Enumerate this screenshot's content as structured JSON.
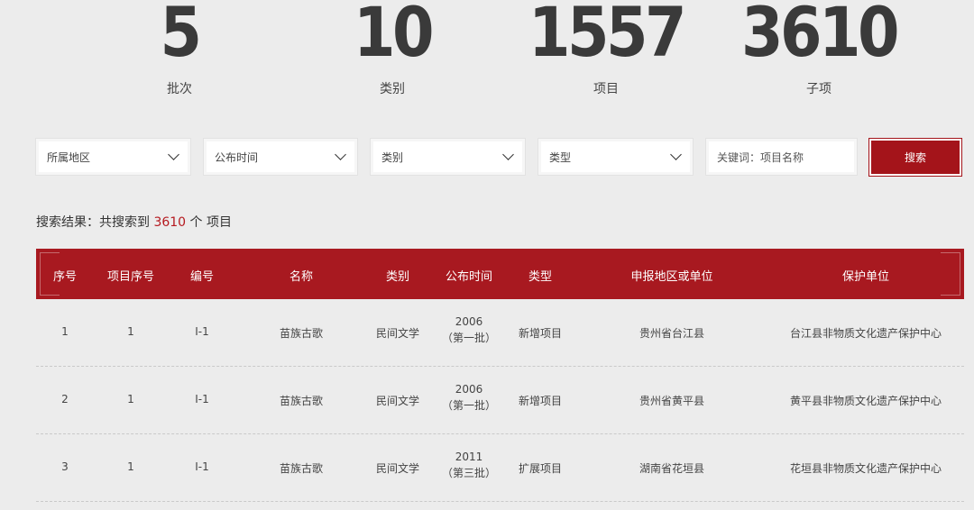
{
  "stats": [
    {
      "value": "5",
      "label": "批次"
    },
    {
      "value": "10",
      "label": "类别"
    },
    {
      "value": "1557",
      "label": "项目"
    },
    {
      "value": "3610",
      "label": "子项"
    }
  ],
  "filters": {
    "region": "所属地区",
    "publish_time": "公布时间",
    "category": "类别",
    "type": "类型",
    "keyword_placeholder": "关键词：项目名称",
    "search_label": "搜索"
  },
  "result": {
    "prefix": "搜索结果：共搜索到",
    "count": "3610",
    "suffix": "个 项目"
  },
  "table": {
    "headers": [
      "序号",
      "项目序号",
      "编号",
      "名称",
      "类别",
      "公布时间",
      "类型",
      "申报地区或单位",
      "保护单位"
    ],
    "rows": [
      {
        "seq": "1",
        "project_seq": "1",
        "code": "Ⅰ-1",
        "name": "苗族古歌",
        "category": "民间文学",
        "year": "2006",
        "batch": "（第一批）",
        "type": "新增项目",
        "region": "贵州省台江县",
        "unit": "台江县非物质文化遗产保护中心"
      },
      {
        "seq": "2",
        "project_seq": "1",
        "code": "Ⅰ-1",
        "name": "苗族古歌",
        "category": "民间文学",
        "year": "2006",
        "batch": "（第一批）",
        "type": "新增项目",
        "region": "贵州省黄平县",
        "unit": "黄平县非物质文化遗产保护中心"
      },
      {
        "seq": "3",
        "project_seq": "1",
        "code": "Ⅰ-1",
        "name": "苗族古歌",
        "category": "民间文学",
        "year": "2011",
        "batch": "（第三批）",
        "type": "扩展项目",
        "region": "湖南省花垣县",
        "unit": "花垣县非物质文化遗产保护中心"
      }
    ]
  },
  "colors": {
    "accent": "#a81920",
    "background": "#ececec"
  }
}
